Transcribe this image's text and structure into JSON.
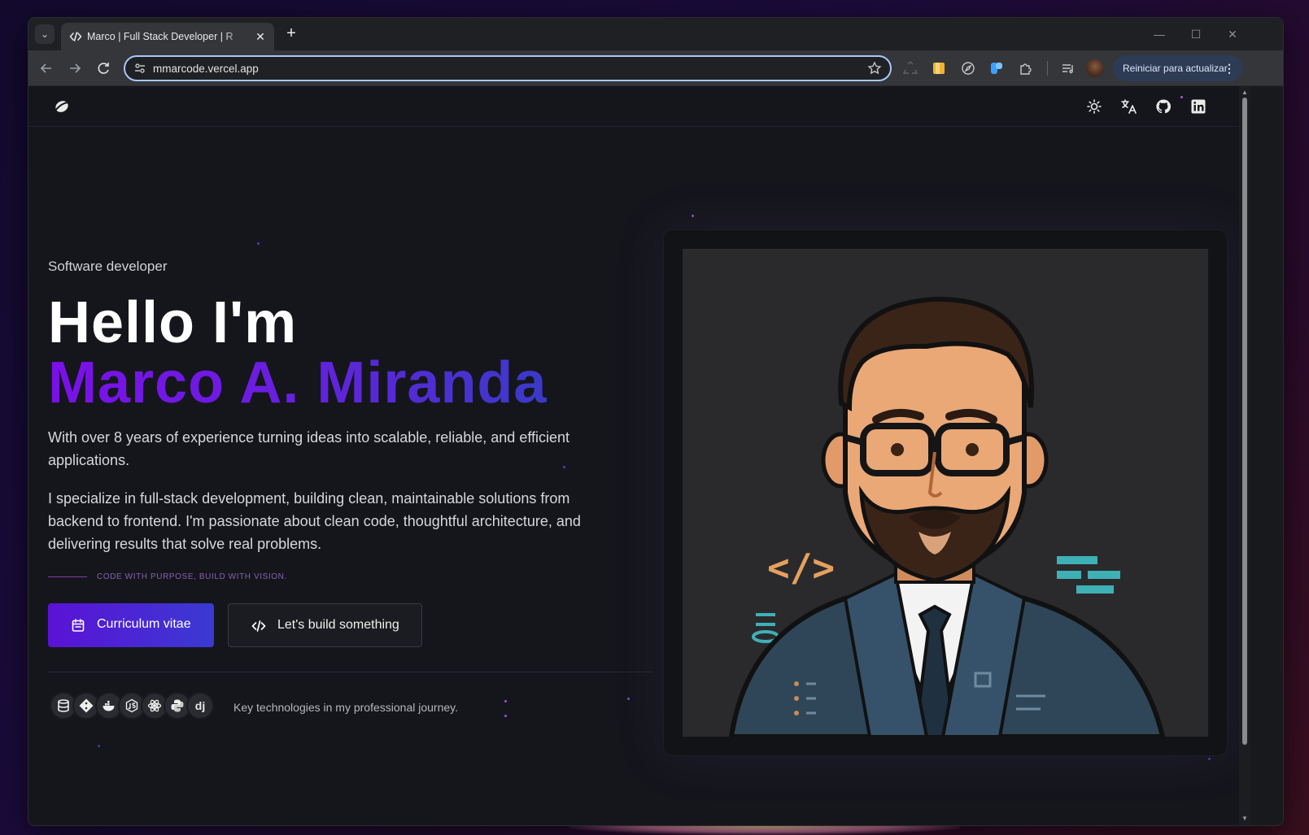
{
  "browser": {
    "tab": {
      "title": "Marco | Full Stack Developer | R"
    },
    "address": {
      "url": "mmarcode.vercel.app"
    },
    "update_button": "Reiniciar para actualizar"
  },
  "site": {
    "hero": {
      "eyebrow": "Software developer",
      "greeting": "Hello I'm",
      "name": "Marco A. Miranda",
      "paragraph1": "With over 8 years of experience turning ideas into scalable, reliable, and efficient applications.",
      "paragraph2": "I specialize in full-stack development, building clean, maintainable solutions from backend to frontend. I'm passionate about clean code, thoughtful architecture, and delivering results that solve real problems.",
      "motto": "CODE WITH PURPOSE, BUILD WITH VISION.",
      "primary_button": "Curriculum vitae",
      "secondary_button": "Let's build something",
      "tech_caption": "Key technologies in my professional journey.",
      "tech_icons": [
        "database-icon",
        "git-icon",
        "docker-icon",
        "nodejs-icon",
        "react-icon",
        "python-icon",
        "django-icon"
      ],
      "django_label": "dj",
      "portrait_code_tag": "</>"
    }
  },
  "colors": {
    "accent_start": "#7a10e8",
    "accent_end": "#3a3ac8",
    "page_bg": "#15161c",
    "motto": "#8b5fb0"
  }
}
